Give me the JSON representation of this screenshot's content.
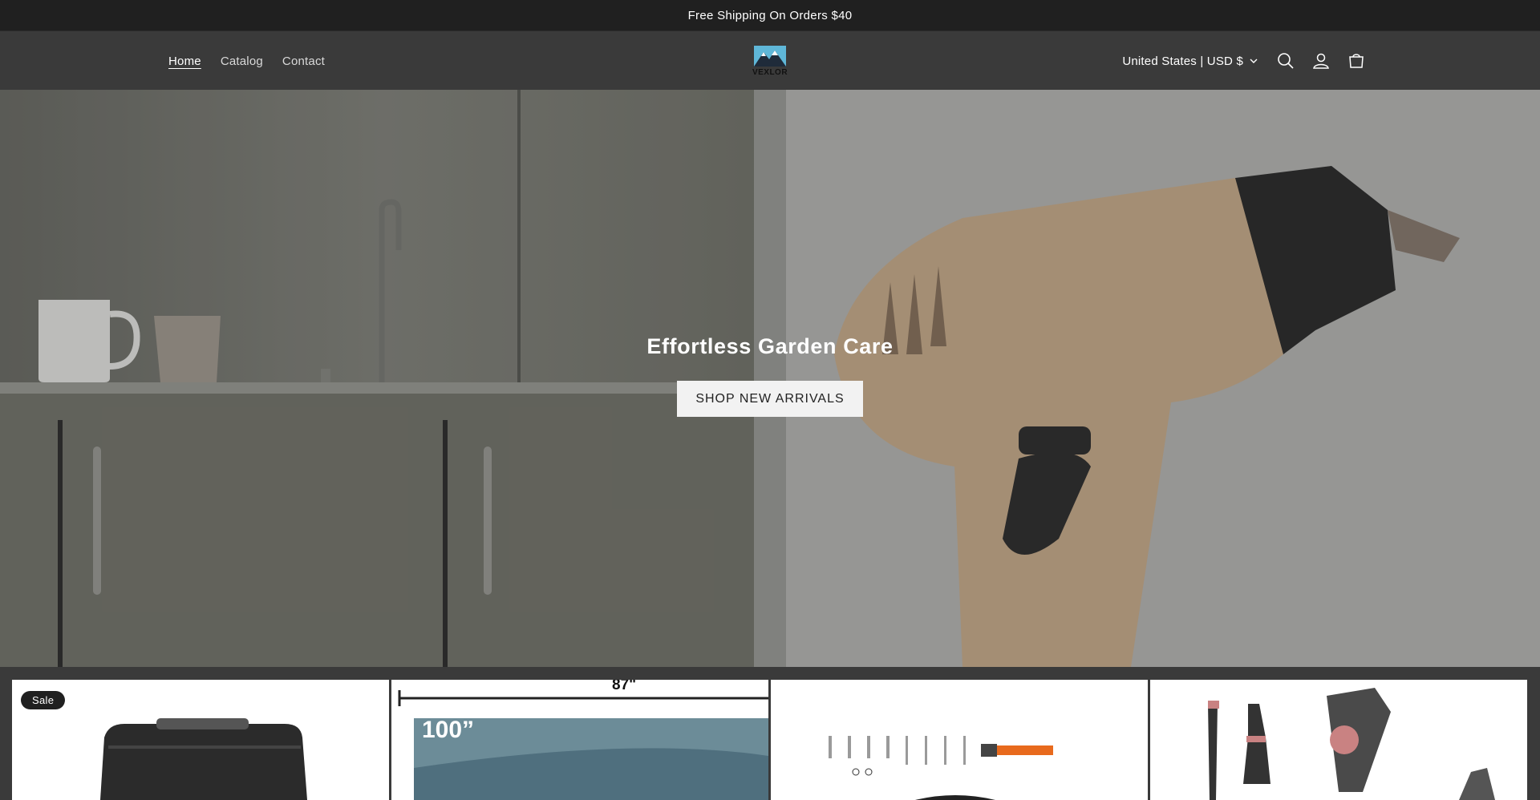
{
  "announcement": "Free Shipping On Orders $40",
  "nav": {
    "home": "Home",
    "catalog": "Catalog",
    "contact": "Contact"
  },
  "brand": {
    "name": "VEXLOR"
  },
  "header": {
    "country": "United States | USD $"
  },
  "hero": {
    "title": "Effortless Garden Care",
    "button": "SHOP NEW ARRIVALS"
  },
  "products": {
    "badge": "Sale",
    "screen_width": "87\"",
    "screen_size": "100”"
  },
  "colors": {
    "announce_bg": "#202020",
    "header_bg": "#3a3a3a",
    "button_bg": "#f2f2f2"
  }
}
